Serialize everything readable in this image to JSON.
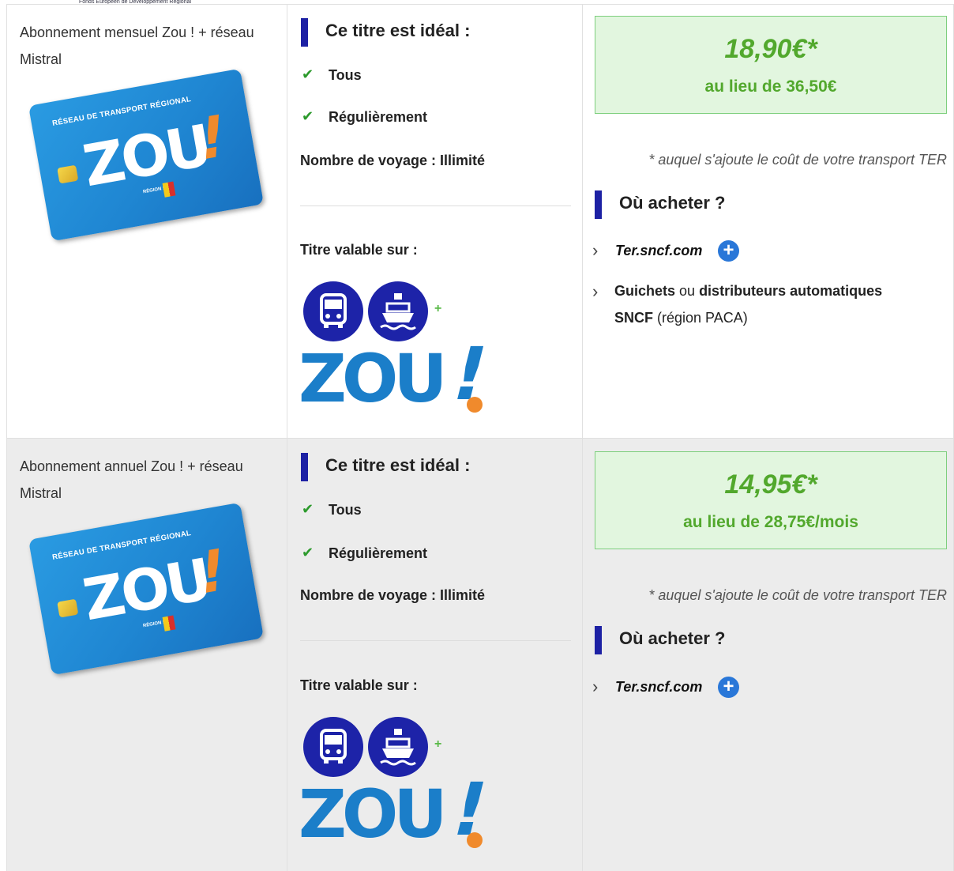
{
  "top_caption": "Fonds Européen de Développement Régional",
  "colors": {
    "brand_bar": "#1d21a4",
    "price_green": "#52a82d",
    "price_box_bg": "#e2f6df",
    "link_plus": "#2977d8"
  },
  "card": {
    "network_label": "RÉSEAU DE TRANSPORT RÉGIONAL",
    "logo": "ZOU",
    "exclaim": "!",
    "region": "RÉGION SUD"
  },
  "valid_logo": {
    "text": "ZOU",
    "exclaim": "!",
    "plus": "+"
  },
  "rows": [
    {
      "product": "Abonnement mensuel Zou ! + réseau Mistral",
      "ideal_title": "Ce titre est idéal :",
      "check_mark": "✔",
      "ideal_items": [
        "Tous",
        "Régulièrement"
      ],
      "trips": "Nombre de voyage : Illimité",
      "valid_on": "Titre valable sur :",
      "price": "18,90€*",
      "instead_of": "au lieu de 36,50€",
      "note": "* auquel s'ajoute le coût de votre transport TER",
      "where_title": "Où acheter ?",
      "buy_link": "Ter.sncf.com",
      "buy_plus": "+",
      "buy_other": {
        "guichets": "Guichets",
        "ou": " ou ",
        "distrib": "distributeurs automatiques",
        "sncf": "SNCF",
        "region": " (région PACA)"
      }
    },
    {
      "product": "Abonnement annuel Zou ! + réseau Mistral",
      "ideal_title": "Ce titre est idéal :",
      "check_mark": "✔",
      "ideal_items": [
        "Tous",
        "Régulièrement"
      ],
      "trips": "Nombre de voyage : Illimité",
      "valid_on": "Titre valable sur :",
      "price": "14,95€*",
      "instead_of": "au lieu de 28,75€/mois",
      "note": "* auquel s'ajoute le coût de votre transport TER",
      "where_title": "Où acheter ?",
      "buy_link": "Ter.sncf.com",
      "buy_plus": "+"
    }
  ]
}
